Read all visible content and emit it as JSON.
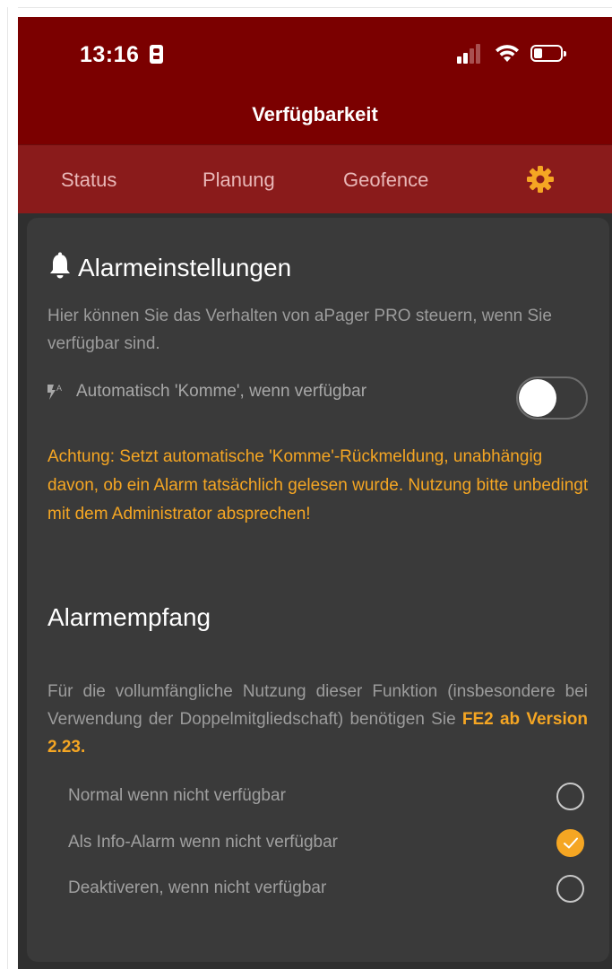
{
  "status_bar": {
    "time": "13:16"
  },
  "header": {
    "title": "Verfügbarkeit"
  },
  "tabs": [
    {
      "label": "Status"
    },
    {
      "label": "Planung"
    },
    {
      "label": "Geofence"
    },
    {
      "icon": "gear-icon",
      "active": true
    }
  ],
  "alarm_settings": {
    "title": "Alarmeinstellungen",
    "description": "Hier können Sie das Verhalten von aPager PRO steuern, wenn Sie verfügbar sind.",
    "toggle_label": "Automatisch 'Komme', wenn verfügbar",
    "toggle_on": false,
    "warning": "Achtung: Setzt automatische 'Komme'-Rückmeldung, unabhängig davon, ob ein Alarm tatsächlich gelesen wurde. Nutzung bitte unbedingt mit dem Administrator absprechen!"
  },
  "alarm_reception": {
    "title": "Alarmempfang",
    "description_prefix": "Für die vollumfängliche Nutzung dieser Funktion (insbesondere bei Verwendung der Doppelmitgliedschaft) benötigen Sie",
    "description_highlight": "FE2 ab Version 2.23.",
    "options": [
      {
        "label": "Normal wenn nicht verfügbar",
        "selected": false
      },
      {
        "label": "Als Info-Alarm wenn nicht verfügbar",
        "selected": true
      },
      {
        "label": "Deaktiveren, wenn nicht verfügbar",
        "selected": false
      }
    ]
  },
  "colors": {
    "header": "#7b0000",
    "tabbar": "#8a1b1b",
    "accent": "#f5a623",
    "background": "#2f2f2f",
    "card": "#3a3a3a"
  }
}
